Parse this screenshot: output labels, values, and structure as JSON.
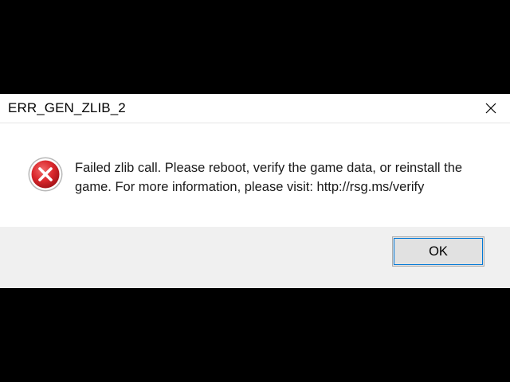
{
  "dialog": {
    "title": "ERR_GEN_ZLIB_2",
    "close_icon": "close-icon",
    "error_icon": "error-icon",
    "message_line1": "Failed zlib call. Please reboot, verify the game data, or reinstall the",
    "message_line2": "game. For more information, please visit: http://rsg.ms/verify",
    "ok_label": "OK"
  },
  "colors": {
    "background": "#000000",
    "dialog": "#ffffff",
    "footer": "#f0f0f0",
    "error_red": "#d9262b",
    "button_focus": "#0078d7"
  }
}
